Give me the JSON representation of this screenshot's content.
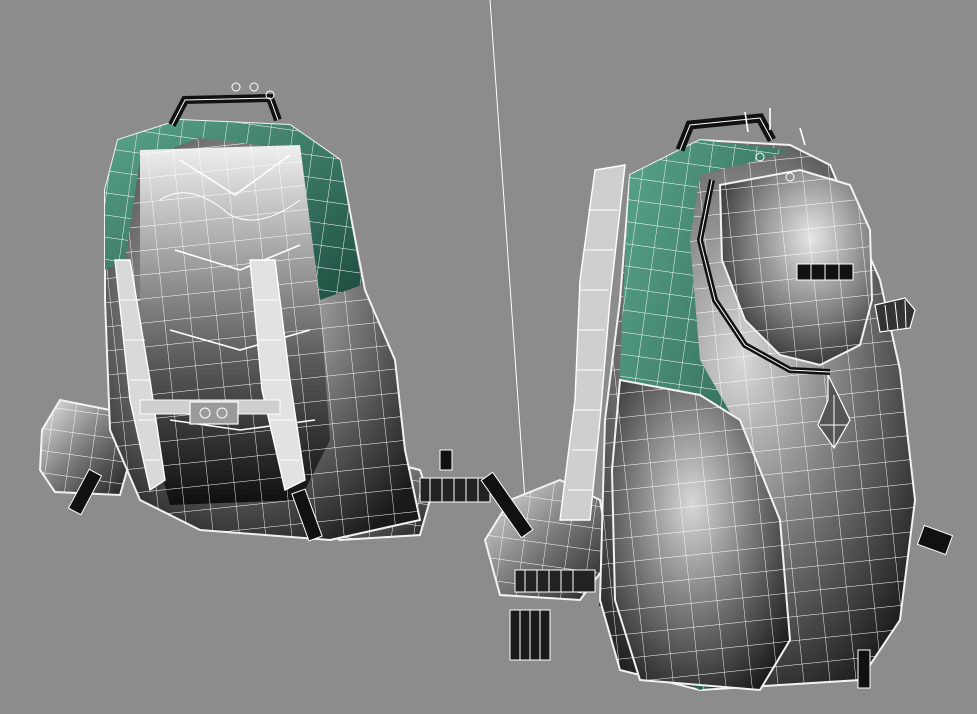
{
  "viewport": {
    "background": "#8c8c8c",
    "render_mode": "wireframe-on-shaded",
    "wire_color": "#ffffff",
    "accent_color": "#3e7e6a"
  },
  "objects": [
    {
      "id": "backpack-back-view",
      "icon": "backpack-icon"
    },
    {
      "id": "backpack-front-view",
      "icon": "backpack-icon"
    }
  ],
  "guides": [
    {
      "id": "light-direction-line"
    }
  ]
}
